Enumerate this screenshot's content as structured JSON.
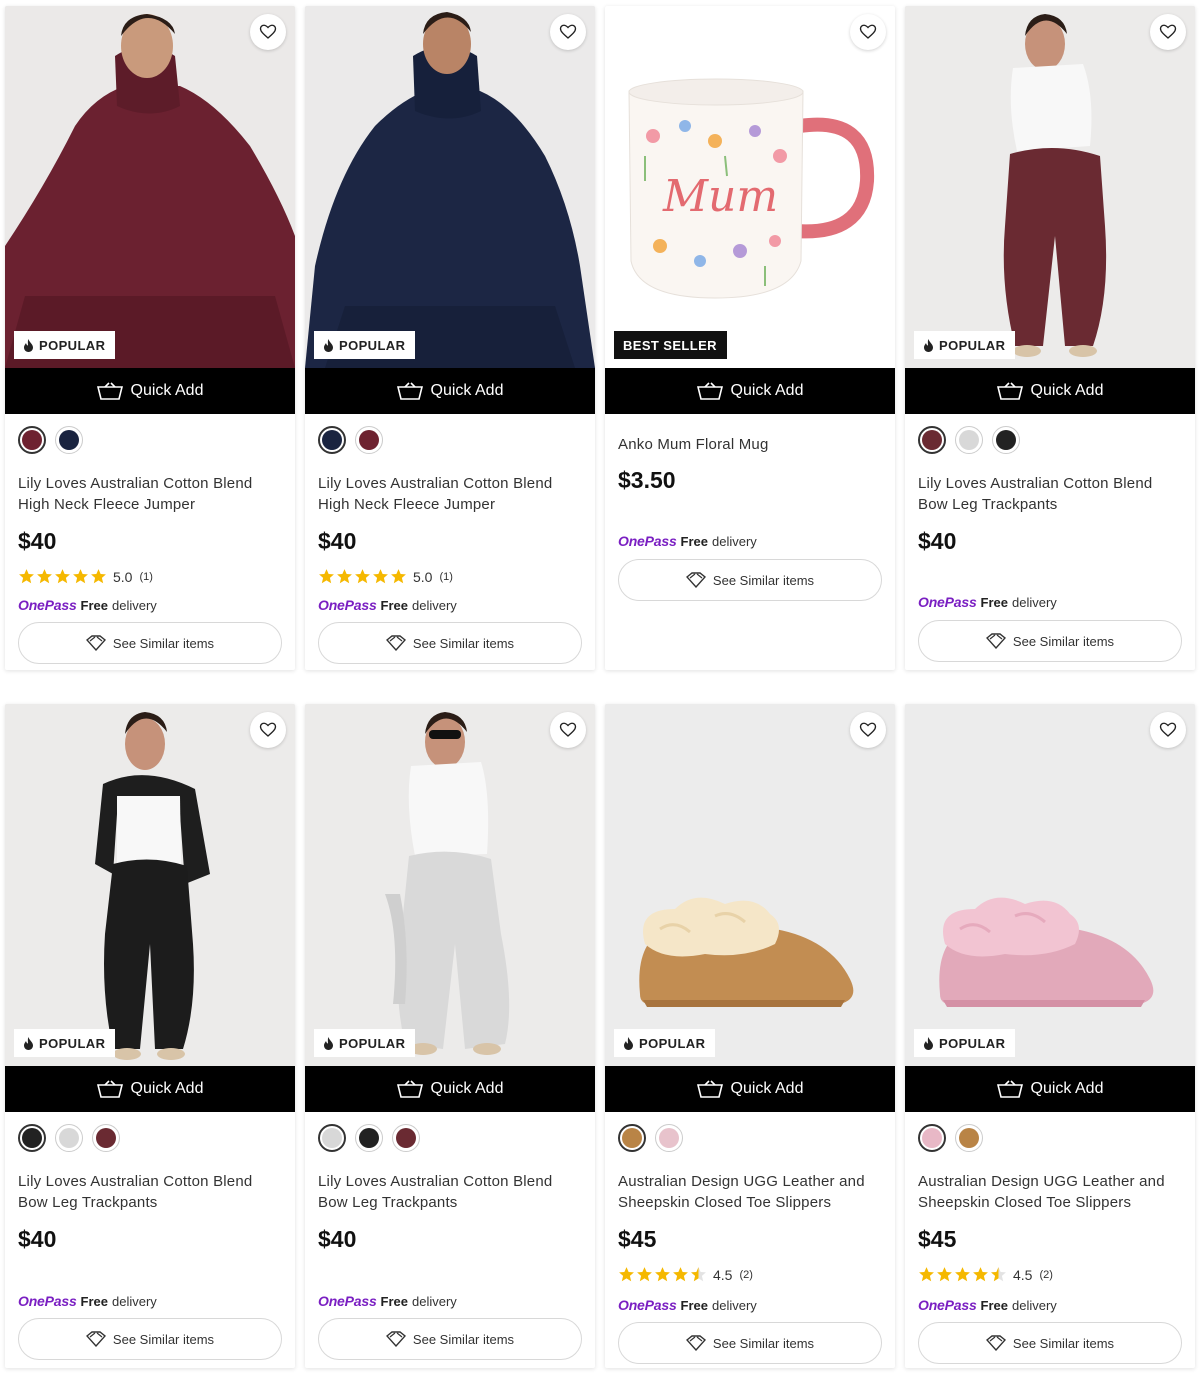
{
  "common": {
    "quick_add": "Quick Add",
    "see_similar": "See Similar items",
    "onepass_brand": "OnePass",
    "free_label": "Free",
    "delivery_label": "delivery",
    "badge_popular": "POPULAR",
    "badge_bestseller": "BEST SELLER"
  },
  "products": [
    {
      "title": "Lily Loves Australian Cotton Blend High Neck Fleece Jumper",
      "price": "$40",
      "rating": "5.0",
      "rating_count": "(1)",
      "stars": 5,
      "badge": "POPULAR",
      "swatches": [
        "#6e2230",
        "#1a2440"
      ]
    },
    {
      "title": "Lily Loves Australian Cotton Blend High Neck Fleece Jumper",
      "price": "$40",
      "rating": "5.0",
      "rating_count": "(1)",
      "stars": 5,
      "badge": "POPULAR",
      "swatches": [
        "#1a2440",
        "#6e2230"
      ]
    },
    {
      "title": "Anko Mum Floral Mug",
      "price": "$3.50",
      "badge": "BEST SELLER",
      "swatches": []
    },
    {
      "title": "Lily Loves Australian Cotton Blend Bow Leg Trackpants",
      "price": "$40",
      "badge": "POPULAR",
      "swatches": [
        "#6a2a32",
        "#d8d8d8",
        "#222222"
      ]
    },
    {
      "title": "Lily Loves Australian Cotton Blend Bow Leg Trackpants",
      "price": "$40",
      "badge": "POPULAR",
      "swatches": [
        "#222222",
        "#d8d8d8",
        "#6a2a32"
      ]
    },
    {
      "title": "Lily Loves Australian Cotton Blend Bow Leg Trackpants",
      "price": "$40",
      "badge": "POPULAR",
      "swatches": [
        "#d8d8d8",
        "#222222",
        "#6a2a32"
      ]
    },
    {
      "title": "Australian Design UGG Leather and Sheepskin Closed Toe Slippers",
      "price": "$45",
      "rating": "4.5",
      "rating_count": "(2)",
      "stars": 4.5,
      "badge": "POPULAR",
      "swatches": [
        "#b98446",
        "#e8c3cc"
      ]
    },
    {
      "title": "Australian Design UGG Leather and Sheepskin Closed Toe Slippers",
      "price": "$45",
      "rating": "4.5",
      "rating_count": "(2)",
      "stars": 4.5,
      "badge": "POPULAR",
      "swatches": [
        "#e8b8c6",
        "#b98446"
      ]
    }
  ],
  "colors": {
    "onepass": "#7a1fc2",
    "star": "#f5b800",
    "quick_add_bg": "#000000"
  },
  "icons": {
    "wishlist": "heart-icon",
    "quick_add": "basket-icon",
    "similar": "similar-icon",
    "badge": "flame-icon"
  }
}
